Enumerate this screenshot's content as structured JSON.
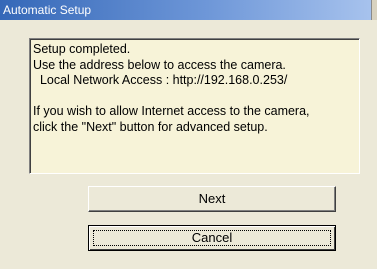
{
  "window": {
    "title": "Automatic Setup"
  },
  "message": {
    "lines": [
      "Setup completed.",
      "Use the address below to access the camera.",
      "  Local Network Access : http://192.168.0.253/",
      "",
      "If you wish to allow Internet access to the camera,",
      "click the \"Next\" button for advanced setup."
    ]
  },
  "buttons": {
    "next_label": "Next",
    "cancel_label": "Cancel"
  },
  "colors": {
    "titlebar_start": "#3568b8",
    "titlebar_end": "#a9c4ee",
    "message_bg": "#f7f3d8",
    "dialog_bg": "#ece9d8"
  }
}
